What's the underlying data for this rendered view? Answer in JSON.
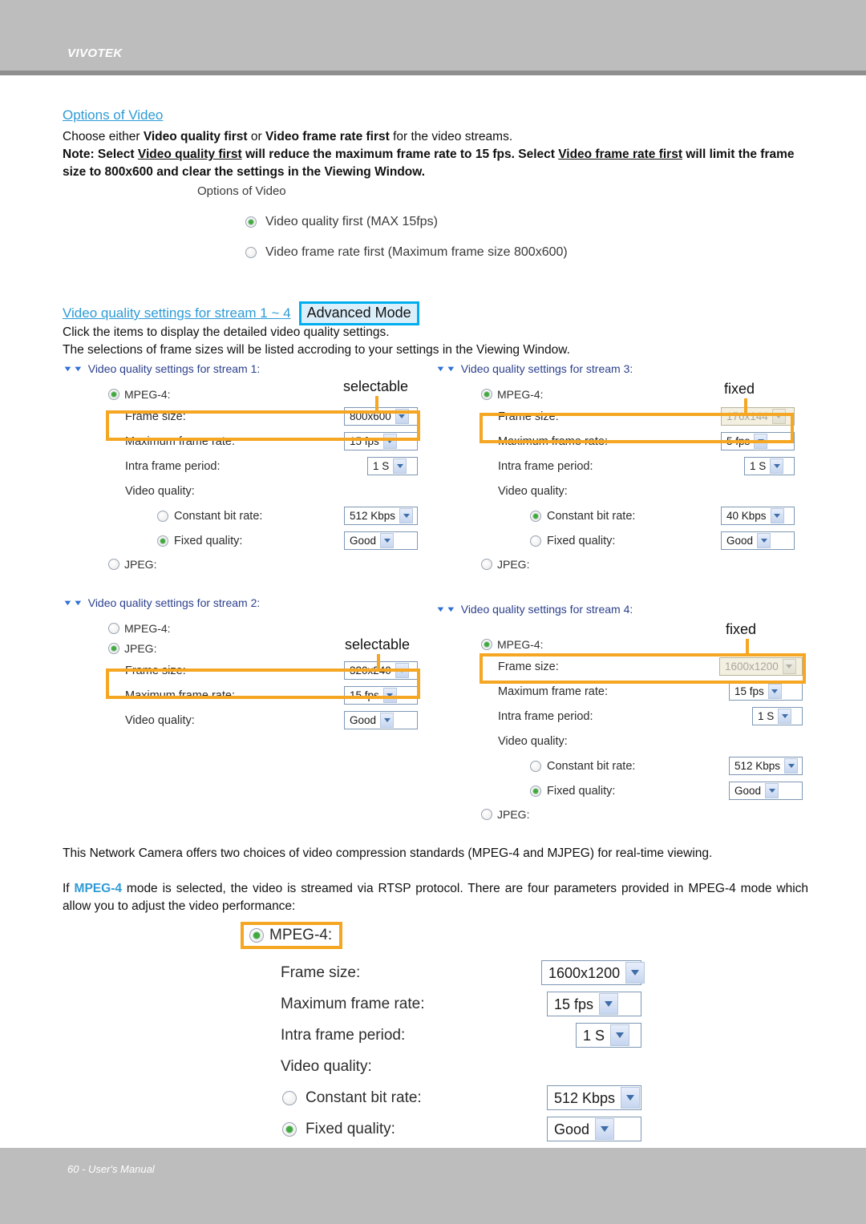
{
  "header": {
    "brand": "VIVOTEK"
  },
  "footer": {
    "page_label": "60 - User's Manual"
  },
  "section1": {
    "heading": "Options of Video",
    "line1_a": "Choose either ",
    "line1_b": "Video quality first",
    "line1_c": " or ",
    "line1_d": "Video frame rate first",
    "line1_e": " for the video streams.",
    "note_a": "Note: Select ",
    "note_b": "Video quality first",
    "note_c": " will reduce the maximum frame rate to 15 fps. Select ",
    "note_d": "Video frame rate first",
    "note_e": " will limit the frame size to 800x600 and clear the settings in the Viewing Window."
  },
  "options_of_video": {
    "title": "Options of Video",
    "choices": [
      {
        "label": "Video quality first (MAX 15fps)",
        "selected": true
      },
      {
        "label": "Video frame rate first (Maximum frame size 800x600)",
        "selected": false
      }
    ]
  },
  "section2": {
    "link": "Video quality settings for stream 1 ~ 4",
    "badge": "Advanced Mode",
    "line1": "Click the items to display the detailed video quality settings.",
    "line2": "The selections of frame sizes will be listed accroding to your settings in the Viewing Window."
  },
  "annotations": {
    "selectable": "selectable",
    "fixed": "fixed"
  },
  "labels": {
    "frame_size": "Frame size:",
    "max_frame_rate": "Maximum frame rate:",
    "intra_frame_period": "Intra frame period:",
    "video_quality": "Video quality:",
    "constant_bit_rate": "Constant bit rate:",
    "fixed_quality": "Fixed quality:",
    "mpeg4": "MPEG-4:",
    "jpeg": "JPEG:"
  },
  "streams": {
    "s1": {
      "header": "Video quality settings for stream 1:",
      "annotation": "selectable",
      "mpeg4_selected": true,
      "jpeg_selected": false,
      "frame_size": "800x600",
      "frame_size_disabled": false,
      "max_frame_rate": "15 fps",
      "intra_frame_period": "1 S",
      "constant_bit_rate_selected": false,
      "constant_bit_rate": "512 Kbps",
      "fixed_quality_selected": true,
      "fixed_quality": "Good"
    },
    "s2": {
      "header": "Video quality settings for stream 2:",
      "annotation": "selectable",
      "mpeg4_selected": false,
      "jpeg_selected": true,
      "frame_size": "320x240",
      "frame_size_disabled": false,
      "max_frame_rate": "15 fps",
      "video_quality": "Good"
    },
    "s3": {
      "header": "Video quality settings for stream 3:",
      "annotation": "fixed",
      "mpeg4_selected": true,
      "jpeg_selected": false,
      "frame_size": "176x144",
      "frame_size_disabled": true,
      "max_frame_rate": "5 fps",
      "intra_frame_period": "1 S",
      "constant_bit_rate_selected": true,
      "constant_bit_rate": "40 Kbps",
      "fixed_quality_selected": false,
      "fixed_quality": "Good"
    },
    "s4": {
      "header": "Video quality settings for stream 4:",
      "annotation": "fixed",
      "mpeg4_selected": true,
      "jpeg_selected": false,
      "frame_size": "1600x1200",
      "frame_size_disabled": true,
      "max_frame_rate": "15 fps",
      "intra_frame_period": "1 S",
      "constant_bit_rate_selected": false,
      "constant_bit_rate": "512 Kbps",
      "fixed_quality_selected": true,
      "fixed_quality": "Good"
    }
  },
  "section3": {
    "p1": "This Network Camera offers two choices of video compression standards (MPEG-4 and MJPEG) for real-time viewing.",
    "p2_a": "If ",
    "p2_kw": "MPEG-4",
    "p2_b": " mode is selected, the video is streamed via RTSP protocol. There are four parameters provided in MPEG-4 mode which allow you to adjust the video performance:"
  },
  "bottom_form": {
    "mpeg4_label": "MPEG-4:",
    "mpeg4_selected": true,
    "frame_size": "1600x1200",
    "max_frame_rate": "15 fps",
    "intra_frame_period": "1 S",
    "constant_bit_rate": "512 Kbps",
    "constant_bit_rate_selected": false,
    "fixed_quality": "Good",
    "fixed_quality_selected": true
  },
  "colors": {
    "highlight": "#f5a623",
    "link": "#2e9bd6",
    "badge_border": "#00aeef",
    "band": "#bdbdbd"
  }
}
